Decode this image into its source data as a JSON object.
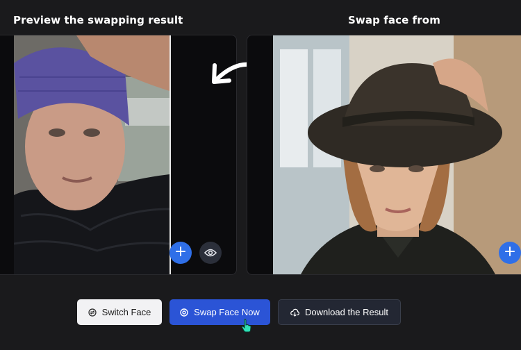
{
  "headings": {
    "preview": "Preview the swapping result",
    "source": "Swap face from"
  },
  "icons": {
    "arrow": "curved-arrow-left-icon",
    "add": "plus-icon",
    "view": "eye-icon",
    "switch": "swap-circle-icon",
    "swap": "target-icon",
    "download": "cloud-download-icon",
    "cursor": "hand-pointer-icon"
  },
  "buttons": {
    "switch_face": "Switch Face",
    "swap_face_now": "Swap Face Now",
    "download_result": "Download the Result"
  },
  "colors": {
    "accent": "#2f6fe8",
    "primary_button": "#2b54d6",
    "background": "#1a1a1c"
  }
}
